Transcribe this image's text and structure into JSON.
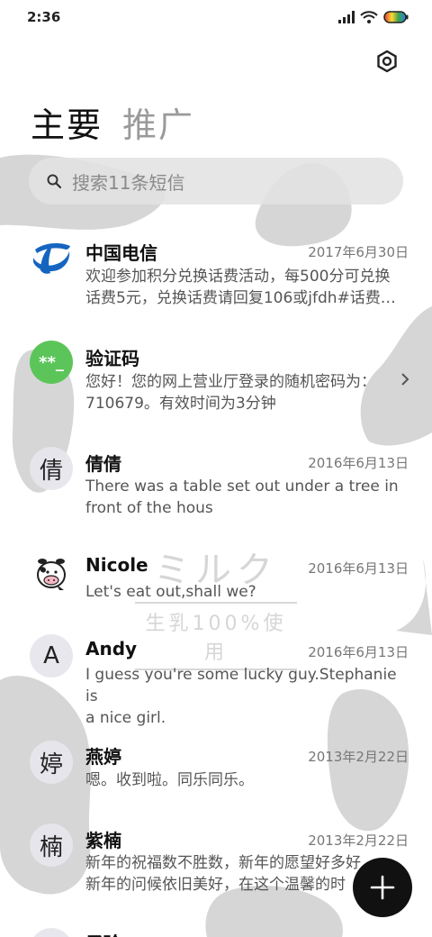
{
  "status_bar": {
    "time": "2:36"
  },
  "tabs": {
    "main": "主要",
    "promotions": "推广"
  },
  "search": {
    "placeholder": "搜索11条短信"
  },
  "watermark": {
    "title": "ミルク",
    "subtitle": "生乳100%使用"
  },
  "messages": [
    {
      "avatar": "",
      "avatar_icon": "china-telecom-logo-icon",
      "name": "中国电信",
      "date": "2017年6月30日",
      "preview_line1": "欢迎参加积分兑换话费活动，每500分可兑换",
      "preview_line2": "话费5元，兑换话费请回复106或jfdh#话费…"
    },
    {
      "avatar": "**_",
      "name": "验证码",
      "date": "",
      "preview_line1": "您好！您的网上营业厅登录的随机密码为：",
      "preview_line2": "710679。有效时间为3分钟"
    },
    {
      "avatar": "倩",
      "name": "倩倩",
      "date": "2016年6月13日",
      "preview_line1": "There was a table set out under a tree in",
      "preview_line2": "front of the hous"
    },
    {
      "avatar": "",
      "avatar_icon": "cow-avatar-icon",
      "name": "Nicole",
      "date": "2016年6月13日",
      "preview_line1": "Let's eat out,shall we?",
      "preview_line2": ""
    },
    {
      "avatar": "A",
      "name": "Andy",
      "date": "2016年6月13日",
      "preview_line1": "I guess you're some lucky guy.Stephanie is",
      "preview_line2": "a nice girl."
    },
    {
      "avatar": "婷",
      "name": "燕婷",
      "date": "2013年2月22日",
      "preview_line1": "嗯。收到啦。同乐同乐。",
      "preview_line2": ""
    },
    {
      "avatar": "楠",
      "name": "紫楠",
      "date": "2013年2月22日",
      "preview_line1": "新年的祝福数不胜数，新年的愿望好多好",
      "preview_line2": "新年的问候依旧美好，在这个温馨的时"
    },
    {
      "avatar": "",
      "name": "子玲",
      "date": "",
      "preview_line1": "",
      "preview_line2": ""
    }
  ],
  "colors": {
    "verification_avatar": "#5cc55a",
    "telecom_blue": "#1565c0",
    "fab": "#111111"
  }
}
